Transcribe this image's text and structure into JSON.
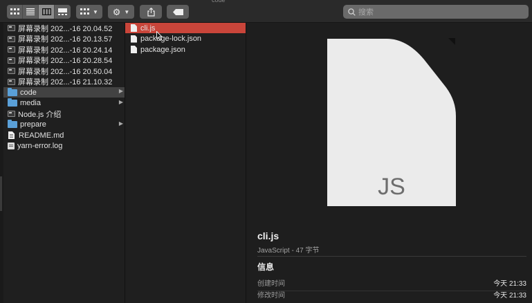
{
  "window": {
    "title_fragment": "code"
  },
  "toolbar": {
    "search_placeholder": "搜索"
  },
  "sidebar_column": {
    "items": [
      {
        "label": "屏幕录制 202...-16 20.04.52",
        "kind": "video"
      },
      {
        "label": "屏幕录制 202...-16 20.13.57",
        "kind": "video"
      },
      {
        "label": "屏幕录制 202...-16 20.24.14",
        "kind": "video"
      },
      {
        "label": "屏幕录制 202...-16 20.28.54",
        "kind": "video"
      },
      {
        "label": "屏幕录制 202...-16 20.50.04",
        "kind": "video"
      },
      {
        "label": "屏幕录制 202...-16 21.10.32",
        "kind": "video"
      },
      {
        "label": "code",
        "kind": "folder",
        "selected": true
      },
      {
        "label": "media",
        "kind": "folder"
      },
      {
        "label": "Node.js 介绍",
        "kind": "video"
      },
      {
        "label": "prepare",
        "kind": "folder"
      },
      {
        "label": "README.md",
        "kind": "file"
      },
      {
        "label": "yarn-error.log",
        "kind": "doc"
      }
    ]
  },
  "code_column": {
    "items": [
      {
        "label": "cli.js",
        "selected": true
      },
      {
        "label": "package-lock.json"
      },
      {
        "label": "package.json"
      }
    ]
  },
  "preview": {
    "file_ext": "JS",
    "name": "cli.js",
    "kind_size": "JavaScript - 47 字节",
    "info_heading": "信息",
    "created_label": "创建时间",
    "created_value": "今天 21:33",
    "modified_label": "修改时间",
    "modified_value": "今天 21:33"
  },
  "colors": {
    "selection_red": "#c9453a",
    "selection_gray": "#424242",
    "folder_blue": "#5aa0d8"
  }
}
